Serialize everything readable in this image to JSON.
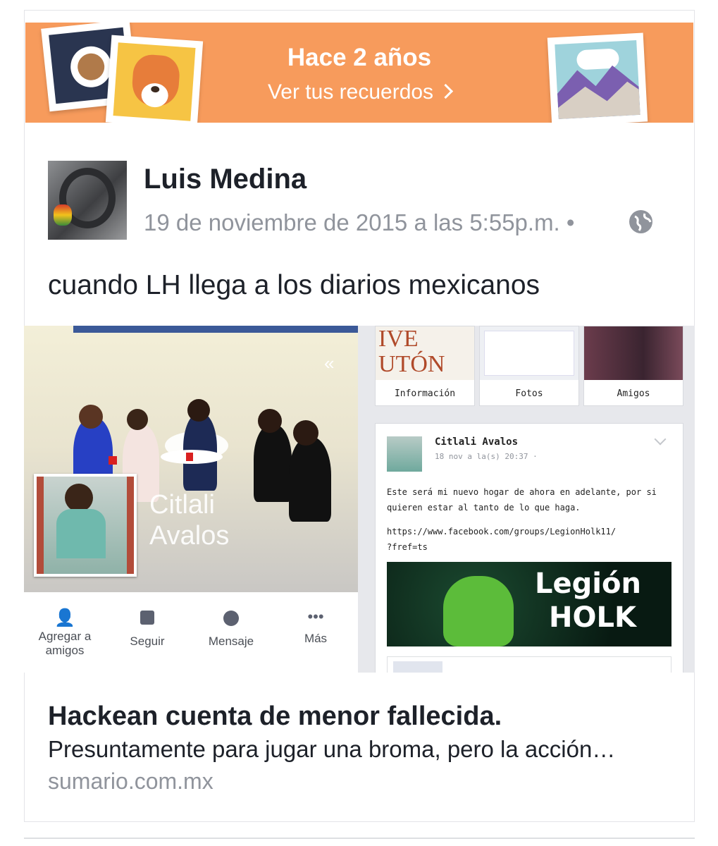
{
  "memories_banner": {
    "title": "Hace 2 años",
    "link_label": "Ver tus recuerdos"
  },
  "post": {
    "author": "Luis Medina",
    "timestamp": "19 de noviembre de 2015 a las 5:55p.m.",
    "separator": "•",
    "privacy_icon": "globe-icon",
    "text": "cuando LH llega a los diarios mexicanos"
  },
  "embedded_screenshot": {
    "profile_name_line1": "Citlali",
    "profile_name_line2": "Avalos",
    "profile_actions": [
      {
        "label": "Agregar a amigos",
        "icon": "add-friend-icon"
      },
      {
        "label": "Seguir",
        "icon": "follow-icon"
      },
      {
        "label": "Mensaje",
        "icon": "messenger-icon"
      },
      {
        "label": "Más",
        "icon": "more-icon"
      }
    ],
    "right_tabs": [
      "Información",
      "Fotos",
      "Amigos"
    ],
    "inner_post": {
      "author": "Citlali Avalos",
      "timestamp": "18 nov a la(s) 20:37 ·",
      "text": "Este será mi nuevo hogar de ahora en adelante, por si quieren estar al tanto de lo que haga.",
      "url_line1": "https://www.facebook.com/groups/LegionHolk11/",
      "url_line2": "?fref=ts",
      "banner_word1": "Legión",
      "banner_word2": "HOLK"
    }
  },
  "link_preview": {
    "title": "Hackean cuenta de menor fallecida.",
    "description": "Presuntamente para jugar una broma, pero la acción…",
    "domain": "sumario.com.mx"
  },
  "colors": {
    "banner": "#f79b5c",
    "text_primary": "#1d2129",
    "text_secondary": "#90949c"
  }
}
